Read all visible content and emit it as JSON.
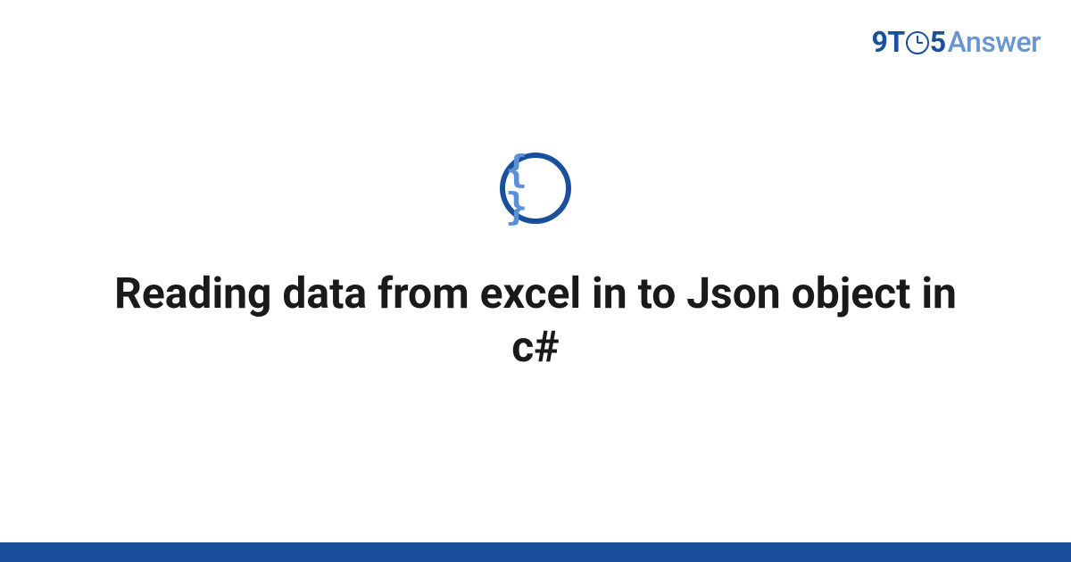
{
  "logo": {
    "part1": "9T",
    "part2": "5",
    "part3": "Answer"
  },
  "badge": {
    "symbol": "{ }"
  },
  "headline": "Reading data from excel in to Json object in c#"
}
